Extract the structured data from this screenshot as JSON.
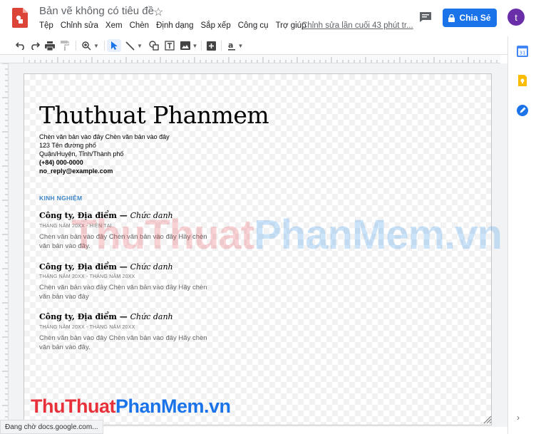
{
  "app": {
    "doc_title": "Bản vẽ không có tiêu đề",
    "last_edit": "Chỉnh sửa lần cuối 43 phút tr...",
    "share_label": "Chia Sẻ",
    "avatar_letter": "t",
    "brand_color": "#1a73e8"
  },
  "menu": [
    "Tệp",
    "Chỉnh sửa",
    "Xem",
    "Chèn",
    "Định dạng",
    "Sắp xếp",
    "Công cụ",
    "Trợ giúp"
  ],
  "toolbar": {
    "icons": [
      "undo-icon",
      "redo-icon",
      "print-icon",
      "paint-format-icon",
      "zoom-icon",
      "select-icon",
      "line-icon",
      "shape-icon",
      "textbox-icon",
      "image-icon",
      "new-slide-icon",
      "wordart-icon"
    ]
  },
  "side_panel": {
    "icons": [
      "calendar-icon",
      "keep-icon",
      "tasks-icon"
    ],
    "calendar_day": "31"
  },
  "resume": {
    "name": "Thuthuat Phanmem",
    "info": [
      "Chèn văn bản vào đây Chèn văn bản vào đây",
      "123 Tên đường phố",
      "Quận/Huyện, Tỉnh/Thành phố",
      "(+84) 000-0000",
      "no_reply@example.com"
    ],
    "section": "KINH NGHIỆM",
    "jobs": [
      {
        "company": "Công ty, Địa điểm — ",
        "role": "Chức danh",
        "date": "THÁNG NĂM 20XX - HIỆN TẠI",
        "desc": "Chèn văn bản vào đây Chèn văn bản vào đây Hãy chèn văn bản vào đây."
      },
      {
        "company": "Công ty, Địa điểm — ",
        "role": "Chức danh",
        "date": "THÁNG NĂM 20XX - THÁNG NĂM 20XX",
        "desc": "Chèn văn bản vào đây Chèn văn bản vào đây Hãy chèn văn bản vào đây"
      },
      {
        "company": "Công ty, Địa điểm — ",
        "role": "Chức danh",
        "date": "THÁNG NĂM 20XX - THÁNG NĂM 20XX",
        "desc": "Chèn văn bản vào đây Chèn văn bản vào đây Hãy chèn văn bản vào đây."
      }
    ]
  },
  "watermark": {
    "part_a": "ThuThuat",
    "part_b": "PhanMem.vn"
  },
  "status": "Đang chờ docs.google.com..."
}
